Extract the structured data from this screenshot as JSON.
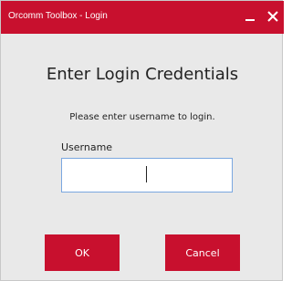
{
  "window": {
    "title": "Orcomm Toolbox - Login"
  },
  "form": {
    "heading": "Enter Login Credentials",
    "subtext": "Please enter username to login.",
    "username_label": "Username",
    "username_value": ""
  },
  "buttons": {
    "ok_label": "OK",
    "cancel_label": "Cancel"
  },
  "icons": {
    "minimize": "minimize-icon",
    "close": "close-icon"
  },
  "colors": {
    "accent": "#c8102e",
    "background": "#e9e9e9",
    "input_border": "#7aa7e0"
  }
}
